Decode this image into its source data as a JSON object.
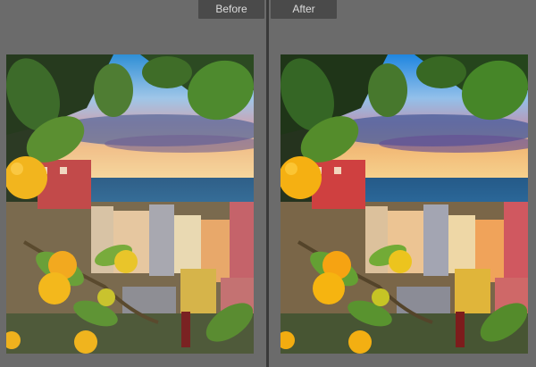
{
  "compare": {
    "before_label": "Before",
    "after_label": "After"
  },
  "photo": {
    "subject": "lemon-branches-over-coastal-village"
  },
  "colors": {
    "panel_bg": "#6b6b6b",
    "divider": "#3a3a3a",
    "label_bg": "#4a4a4a",
    "label_text": "#dcdcdc"
  }
}
